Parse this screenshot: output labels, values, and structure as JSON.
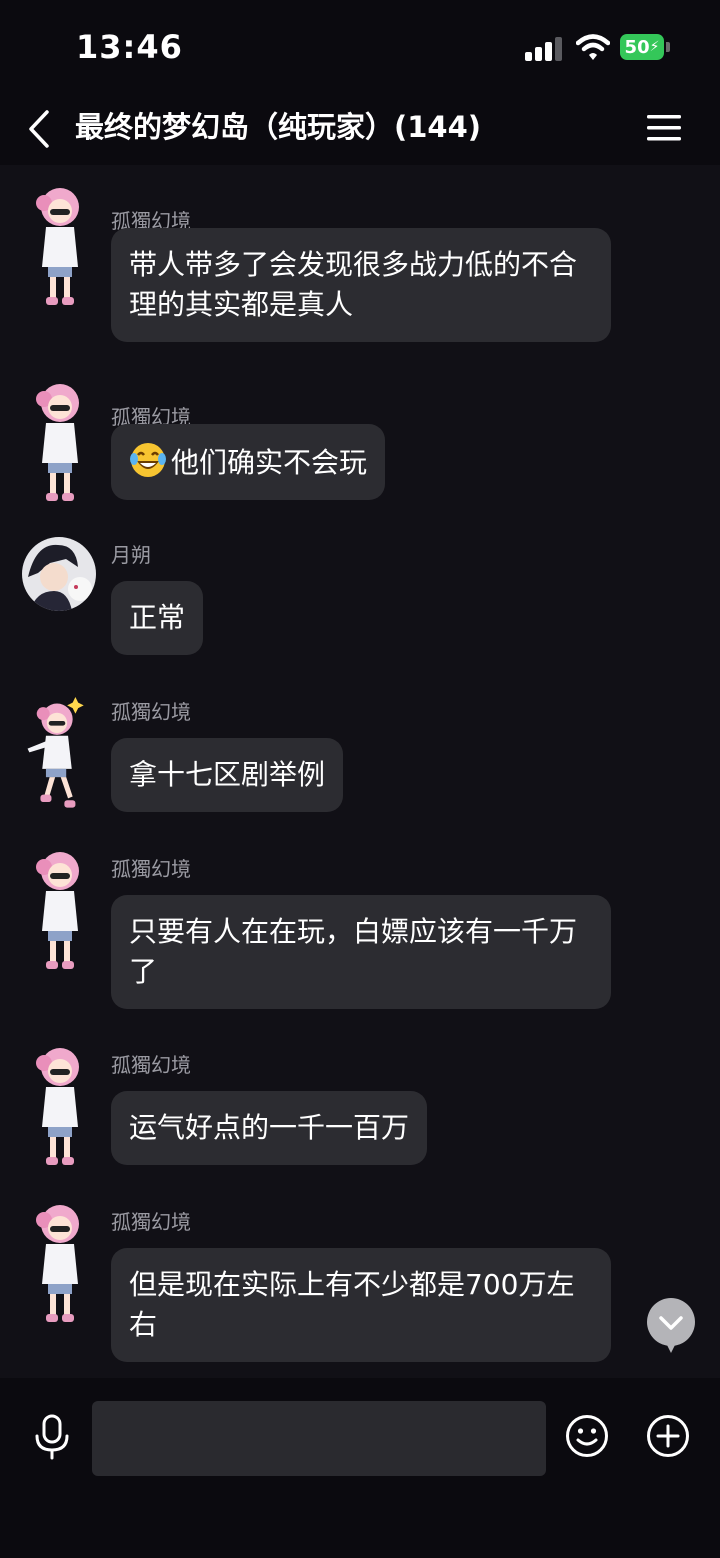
{
  "status_bar": {
    "time": "13:46",
    "battery": "50"
  },
  "header": {
    "title": "最终的梦幻岛（纯玩家）(144)"
  },
  "messages": [
    {
      "sender": "孤獨幻境",
      "text": "带人带多了会发现很多战力低的不合理的其实都是真人"
    },
    {
      "sender": "孤獨幻境",
      "emoji": "laughing-crying-emoji",
      "text": "他们确实不会玩"
    },
    {
      "sender": "月朔",
      "text": "正常"
    },
    {
      "sender": "孤獨幻境",
      "text": "拿十七区剧举例"
    },
    {
      "sender": "孤獨幻境",
      "text": "只要有人在在玩，白嫖应该有一千万了"
    },
    {
      "sender": "孤獨幻境",
      "text": "运气好点的一千一百万"
    },
    {
      "sender": "孤獨幻境",
      "text": "但是现在实际上有不少都是700万左右"
    }
  ],
  "input": {
    "placeholder": ""
  },
  "colors": {
    "background": "#111016",
    "bubble": "#2c2c31",
    "name": "#9a9aa2",
    "battery": "#34c759"
  }
}
